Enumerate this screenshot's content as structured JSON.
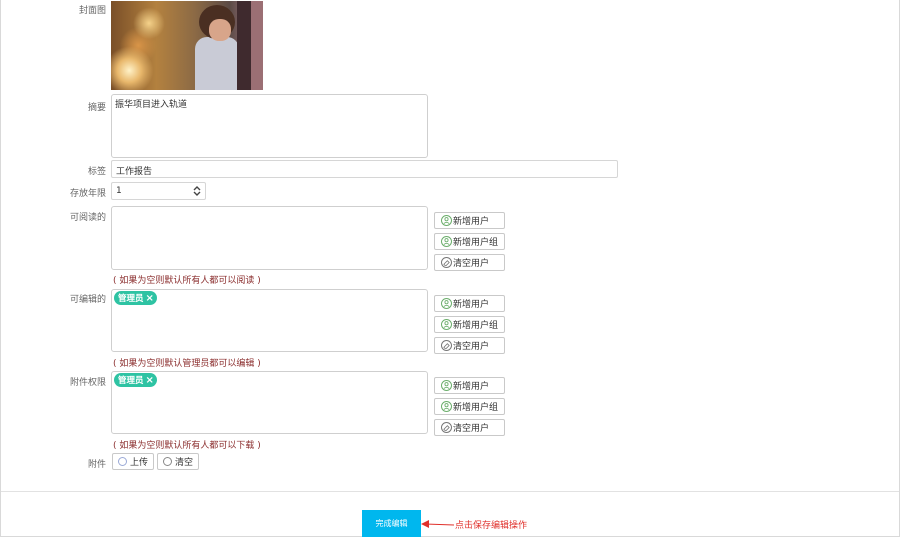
{
  "form": {
    "cover_label": "封面图",
    "summary_label": "摘要",
    "summary_value": "振华项目进入轨道",
    "tags_label": "标签",
    "tags_value": "工作报告",
    "retention_label": "存放年限",
    "retention_value": "1",
    "readable": {
      "label": "可阅读的",
      "hint": "( 如果为空则默认所有人都可以阅读 )",
      "tags": []
    },
    "editable": {
      "label": "可编辑的",
      "hint": "( 如果为空则默认管理员都可以编辑 )",
      "tags": [
        "管理员"
      ]
    },
    "attachment_perm": {
      "label": "附件权限",
      "hint": "( 如果为空则默认所有人都可以下载 )",
      "tags": [
        "管理员"
      ]
    },
    "buttons": {
      "add_user": "新增用户",
      "add_group": "新增用户组",
      "clear_users": "清空用户"
    },
    "attachment": {
      "label": "附件",
      "upload": "上传",
      "clear": "清空"
    }
  },
  "footer": {
    "save_button": "完成编辑",
    "annotation": "点击保存编辑操作"
  },
  "colors": {
    "tag_bg": "#2ec3a3",
    "save_bg": "#00b7ee",
    "hint_text": "#8b2e2e",
    "annotation": "#e0302b"
  }
}
